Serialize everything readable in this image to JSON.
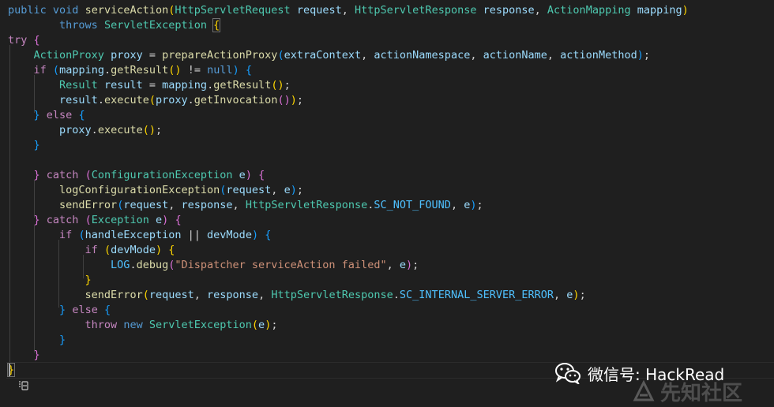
{
  "code": {
    "line1": {
      "public": "public",
      "void": "void",
      "method": "serviceAction",
      "p_open": "(",
      "type1": "HttpServletRequest",
      "arg1": "request",
      "comma1": ",",
      "type2": "HttpServletResponse",
      "arg2": "response",
      "comma2": ",",
      "type3": "ActionMapping",
      "arg3": "mapping",
      "p_close": ")"
    },
    "line2": {
      "throws": "throws",
      "exc": "ServletException",
      "brace": "{"
    },
    "line3": {
      "try": "try",
      "brace": "{"
    },
    "line4": {
      "type": "ActionProxy",
      "var": "proxy",
      "eq": "=",
      "fn": "prepareActionProxy",
      "po": "(",
      "a1": "extraContext",
      "c1": ",",
      "a2": "actionNamespace",
      "c2": ",",
      "a3": "actionName",
      "c3": ",",
      "a4": "actionMethod",
      "pc": ")",
      "semi": ";"
    },
    "line5": {
      "if": "if",
      "po": "(",
      "obj": "mapping",
      "dot": ".",
      "fn": "getResult",
      "ppo": "(",
      "ppc": ")",
      "neq": "!=",
      "null": "null",
      "pc": ")",
      "brace": "{"
    },
    "line6": {
      "type": "Result",
      "var": "result",
      "eq": "=",
      "obj": "mapping",
      "dot": ".",
      "fn": "getResult",
      "po": "(",
      "pc": ")",
      "semi": ";"
    },
    "line7": {
      "obj": "result",
      "dot": ".",
      "fn": "execute",
      "po": "(",
      "obj2": "proxy",
      "dot2": ".",
      "fn2": "getInvocation",
      "ppo": "(",
      "ppc": ")",
      "pc": ")",
      "semi": ";"
    },
    "line8": {
      "close": "}",
      "else": "else",
      "brace": "{"
    },
    "line9": {
      "obj": "proxy",
      "dot": ".",
      "fn": "execute",
      "po": "(",
      "pc": ")",
      "semi": ";"
    },
    "line10": {
      "close": "}"
    },
    "line12": {
      "close": "}",
      "catch": "catch",
      "po": "(",
      "type": "ConfigurationException",
      "var": "e",
      "pc": ")",
      "brace": "{"
    },
    "line13": {
      "fn": "logConfigurationException",
      "po": "(",
      "a1": "request",
      "c1": ",",
      "a2": "e",
      "pc": ")",
      "semi": ";"
    },
    "line14": {
      "fn": "sendError",
      "po": "(",
      "a1": "request",
      "c1": ",",
      "a2": "response",
      "c2": ",",
      "type": "HttpServletResponse",
      "dot": ".",
      "const": "SC_NOT_FOUND",
      "c3": ",",
      "a3": "e",
      "pc": ")",
      "semi": ";"
    },
    "line15": {
      "close": "}",
      "catch": "catch",
      "po": "(",
      "type": "Exception",
      "var": "e",
      "pc": ")",
      "brace": "{"
    },
    "line16": {
      "if": "if",
      "po": "(",
      "fn": "handleException",
      "or": "||",
      "var": "devMode",
      "pc": ")",
      "brace": "{"
    },
    "line17": {
      "if": "if",
      "po": "(",
      "var": "devMode",
      "pc": ")",
      "brace": "{"
    },
    "line18": {
      "obj": "LOG",
      "dot": ".",
      "fn": "debug",
      "po": "(",
      "str": "\"Dispatcher serviceAction failed\"",
      "c1": ",",
      "a1": "e",
      "pc": ")",
      "semi": ";"
    },
    "line19": {
      "close": "}"
    },
    "line20": {
      "fn": "sendError",
      "po": "(",
      "a1": "request",
      "c1": ",",
      "a2": "response",
      "c2": ",",
      "type": "HttpServletResponse",
      "dot": ".",
      "const": "SC_INTERNAL_SERVER_ERROR",
      "c3": ",",
      "a3": "e",
      "pc": ")",
      "semi": ";"
    },
    "line21": {
      "close": "}",
      "else": "else",
      "brace": "{"
    },
    "line22": {
      "throw": "throw",
      "new": "new",
      "type": "ServletException",
      "po": "(",
      "var": "e",
      "pc": ")",
      "semi": ";"
    },
    "line23": {
      "close": "}"
    },
    "line24": {
      "close": "}"
    },
    "line25": {
      "close": "}"
    }
  },
  "watermark": {
    "wechat_text": "微信号: HackRead",
    "site_text": "先知社区"
  },
  "colors": {
    "background": "#1f1f1f",
    "keyword": "#569cd6",
    "control": "#c586c0",
    "function": "#dcdcaa",
    "type": "#4ec9b0",
    "variable": "#9cdcfe",
    "string": "#ce9178"
  },
  "icons": {
    "fold": "list-indent-icon",
    "wechat": "wechat-icon",
    "site": "xianzhi-logo-icon"
  }
}
